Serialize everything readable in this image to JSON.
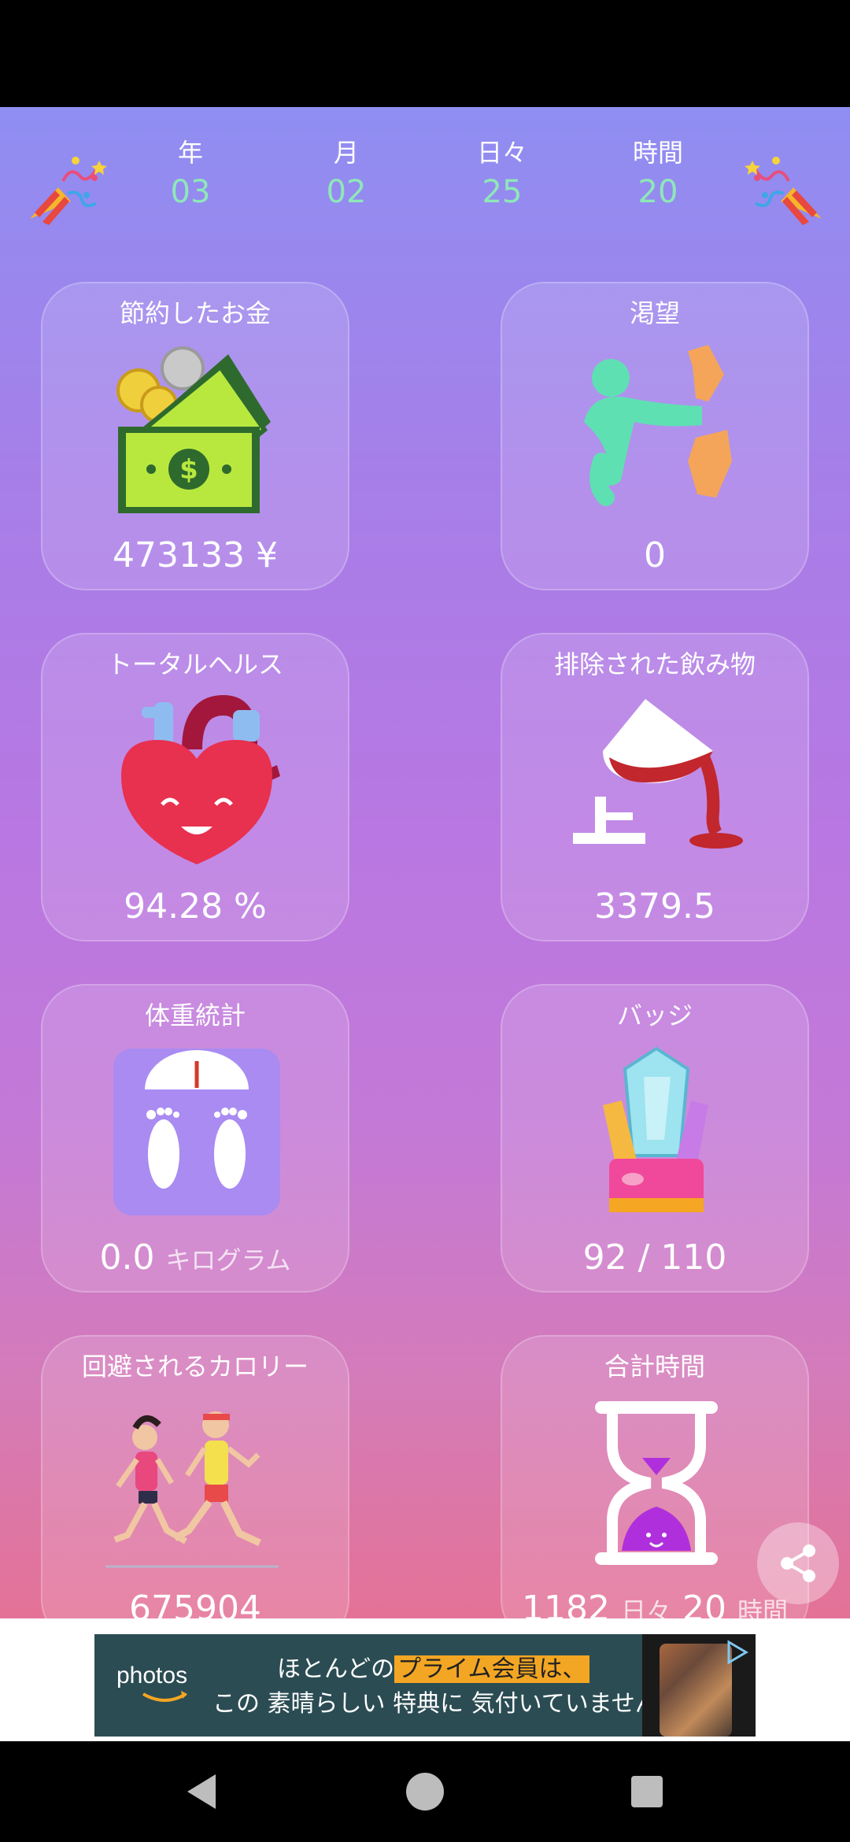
{
  "counters": [
    {
      "label": "年",
      "value": "03"
    },
    {
      "label": "月",
      "value": "02"
    },
    {
      "label": "日々",
      "value": "25"
    },
    {
      "label": "時間",
      "value": "20"
    }
  ],
  "cards": {
    "money": {
      "title": "節約したお金",
      "value": "473133 ¥"
    },
    "craving": {
      "title": "渇望",
      "value": "0"
    },
    "health": {
      "title": "トータルヘルス",
      "value": "94.28 %"
    },
    "drinks": {
      "title": "排除された飲み物",
      "value": "3379.5"
    },
    "weight": {
      "title": "体重統計",
      "value": "0.0",
      "unit": "キログラム"
    },
    "badges": {
      "title": "バッジ",
      "value": "92 / 110"
    },
    "calories": {
      "title": "回避されるカロリー",
      "value": "675904"
    },
    "total_time": {
      "title": "合計時間",
      "value_days": "1182",
      "unit_days": "日々",
      "value_hours": "20",
      "unit_hours": "時間"
    }
  },
  "ad": {
    "brand": "photos",
    "line1_pre": "ほとんどの",
    "line1_highlight": "プライム会員は、",
    "line2": "この 素晴らしい 特典に 気付いていません"
  },
  "colors": {
    "accent_green": "#8ee7b8",
    "share_button": "#ffffff"
  },
  "icons": {
    "party": "party-popper-icon",
    "share": "share-icon",
    "nav_back": "back-triangle-icon",
    "nav_home": "home-circle-icon",
    "nav_recent": "recent-square-icon"
  }
}
